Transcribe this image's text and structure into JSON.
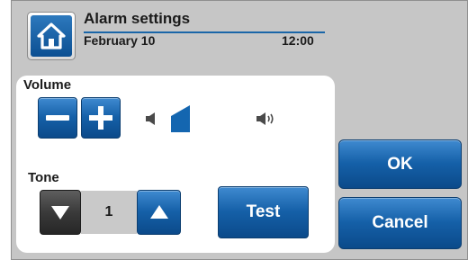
{
  "header": {
    "title": "Alarm settings",
    "date": "February 10",
    "time": "12:00"
  },
  "volume": {
    "label": "Volume",
    "level_fraction": 0.2
  },
  "tone": {
    "label": "Tone",
    "value": "1"
  },
  "buttons": {
    "test": "Test",
    "ok": "OK",
    "cancel": "Cancel"
  },
  "icons": {
    "home": "home-icon",
    "minus": "minus-icon",
    "plus": "plus-icon",
    "speaker_low": "speaker-low-icon",
    "speaker_high": "speaker-high-icon",
    "arrow_down": "arrow-down-icon",
    "arrow_up": "arrow-up-icon"
  },
  "colors": {
    "accent_blue": "#1560a8",
    "background": "#c6c6c6",
    "panel": "#ffffff"
  }
}
